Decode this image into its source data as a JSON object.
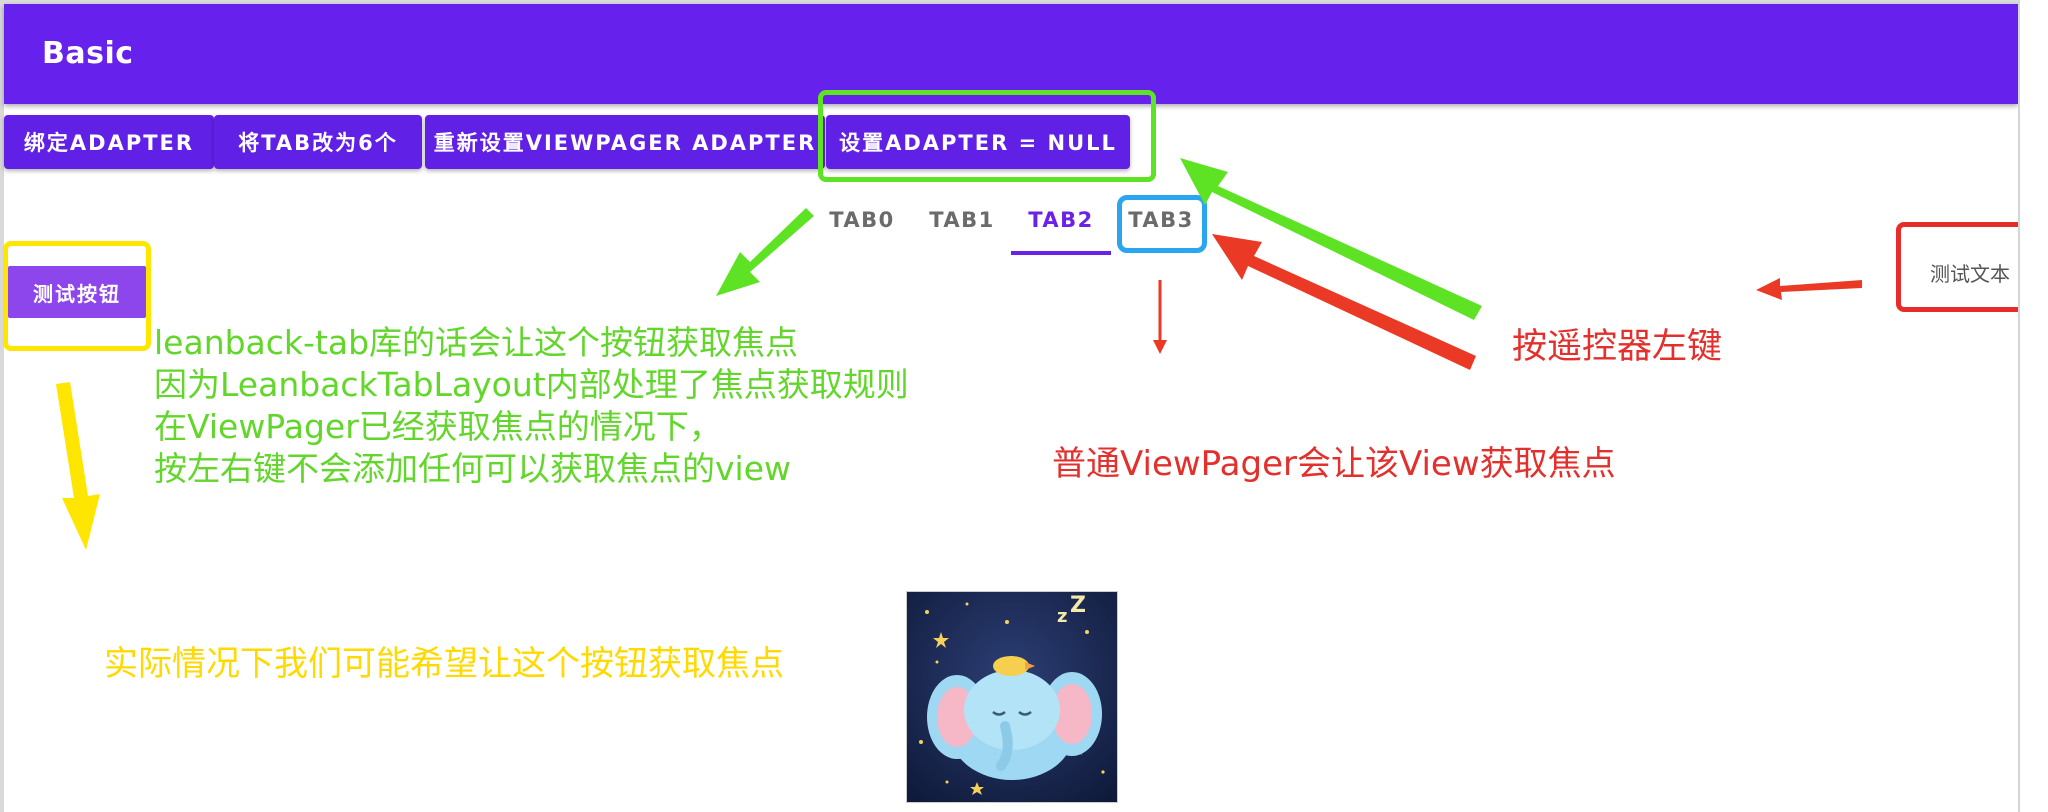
{
  "app": {
    "title": "Basic"
  },
  "buttons": [
    {
      "label": "绑定ADAPTER"
    },
    {
      "label": "将TAB改为6个"
    },
    {
      "label": "重新设置VIEWPAGER ADAPTER"
    },
    {
      "label": "设置ADAPTER = NULL"
    }
  ],
  "tabs": [
    {
      "label": "TAB0",
      "selected": false
    },
    {
      "label": "TAB1",
      "selected": false
    },
    {
      "label": "TAB2",
      "selected": true
    },
    {
      "label": "TAB3",
      "selected": false
    }
  ],
  "test_button": {
    "label": "测试按钮"
  },
  "test_text": {
    "label": "测试文本"
  },
  "annotations": {
    "green_note": [
      "leanback-tab库的话会让这个按钮获取焦点",
      "因为LeanbackTabLayout内部处理了焦点获取规则",
      "在ViewPager已经获取焦点的情况下，",
      "按左右键不会添加任何可以获取焦点的view"
    ],
    "red_note": "普通ViewPager会让该View获取焦点",
    "red_note_remote": "按遥控器左键",
    "yellow_note": "实际情况下我们可能希望让这个按钮获取焦点"
  },
  "colors": {
    "primary": "#6621ec",
    "accent_tab": "#6a22e6",
    "annotation_green": "#5ee224",
    "annotation_red": "#e3302c",
    "annotation_yellow": "#ffe600",
    "annotation_blue": "#2aa6f0"
  }
}
